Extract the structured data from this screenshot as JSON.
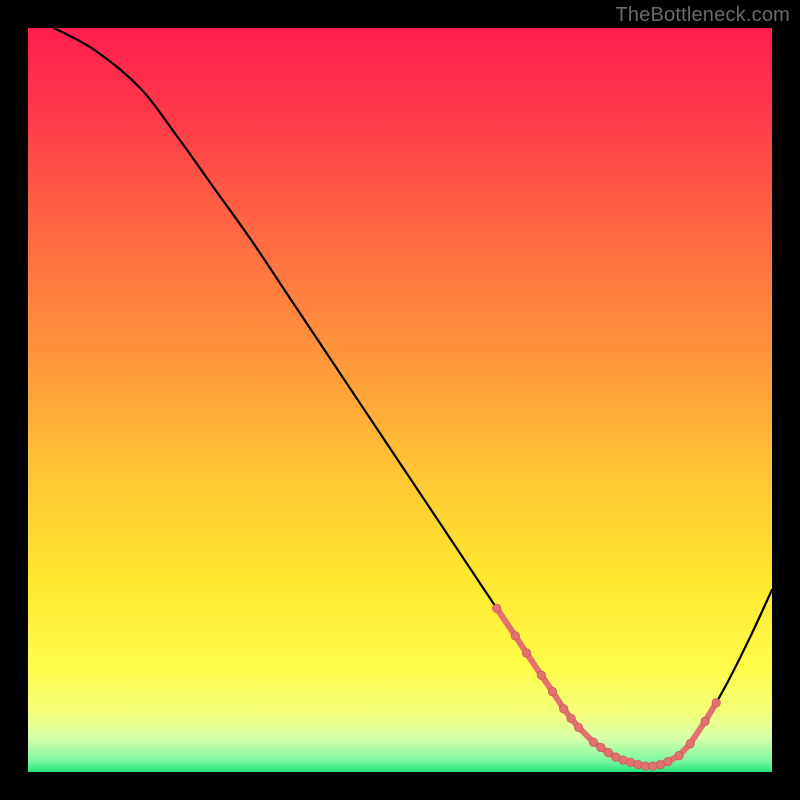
{
  "credit_text": "TheBottleneck.com",
  "colors": {
    "frame": "#000000",
    "curve": "#000000",
    "marker_fill": "#e2716f",
    "marker_stroke": "#c95b59",
    "credit_text": "#6a6a6a",
    "gradient_stops": [
      {
        "offset": 0.0,
        "color": "#ff1f4f"
      },
      {
        "offset": 0.12,
        "color": "#ff3a49"
      },
      {
        "offset": 0.28,
        "color": "#ff6a42"
      },
      {
        "offset": 0.45,
        "color": "#ff983a"
      },
      {
        "offset": 0.6,
        "color": "#ffc634"
      },
      {
        "offset": 0.74,
        "color": "#ffe72e"
      },
      {
        "offset": 0.86,
        "color": "#fffc4a"
      },
      {
        "offset": 0.92,
        "color": "#f4ff7a"
      },
      {
        "offset": 0.955,
        "color": "#d6ffab"
      },
      {
        "offset": 0.985,
        "color": "#7cf7a1"
      },
      {
        "offset": 1.0,
        "color": "#23e47a"
      }
    ]
  },
  "chart_data": {
    "type": "line",
    "title": "",
    "xlabel": "",
    "ylabel": "",
    "xlim": [
      0,
      100
    ],
    "ylim": [
      0,
      100
    ],
    "grid": false,
    "legend": false,
    "x": [
      3.5,
      9.0,
      15.0,
      20.0,
      25.0,
      30.0,
      35.0,
      40.0,
      45.0,
      50.0,
      55.0,
      58.0,
      60.0,
      63.0,
      65.0,
      67.0,
      70.0,
      72.0,
      74.0,
      76.0,
      78.0,
      79.0,
      80.0,
      81.0,
      82.0,
      83.0,
      84.0,
      85.0,
      86.0,
      88.0,
      90.0,
      92.0,
      94.0,
      97.0,
      100.0
    ],
    "values": [
      100.0,
      97.0,
      92.0,
      85.5,
      78.5,
      71.5,
      64.0,
      56.5,
      49.0,
      41.5,
      34.0,
      29.5,
      26.5,
      22.0,
      19.0,
      16.0,
      11.5,
      8.5,
      6.0,
      4.0,
      2.6,
      2.0,
      1.6,
      1.3,
      1.0,
      0.8,
      0.8,
      1.0,
      1.4,
      3.0,
      5.5,
      8.5,
      12.0,
      18.0,
      24.5
    ],
    "markers": {
      "x": [
        63.0,
        65.5,
        67.0,
        69.0,
        70.5,
        72.0,
        73.0,
        74.0,
        76.0,
        77.0,
        78.0,
        79.0,
        80.0,
        81.0,
        82.0,
        83.0,
        84.0,
        85.0,
        86.0,
        87.5,
        89.0,
        91.0,
        92.5
      ],
      "y": [
        22.0,
        18.3,
        16.0,
        13.0,
        10.8,
        8.5,
        7.2,
        6.0,
        4.0,
        3.3,
        2.6,
        2.0,
        1.6,
        1.3,
        1.0,
        0.8,
        0.8,
        1.0,
        1.4,
        2.2,
        3.8,
        6.8,
        9.3
      ]
    }
  }
}
